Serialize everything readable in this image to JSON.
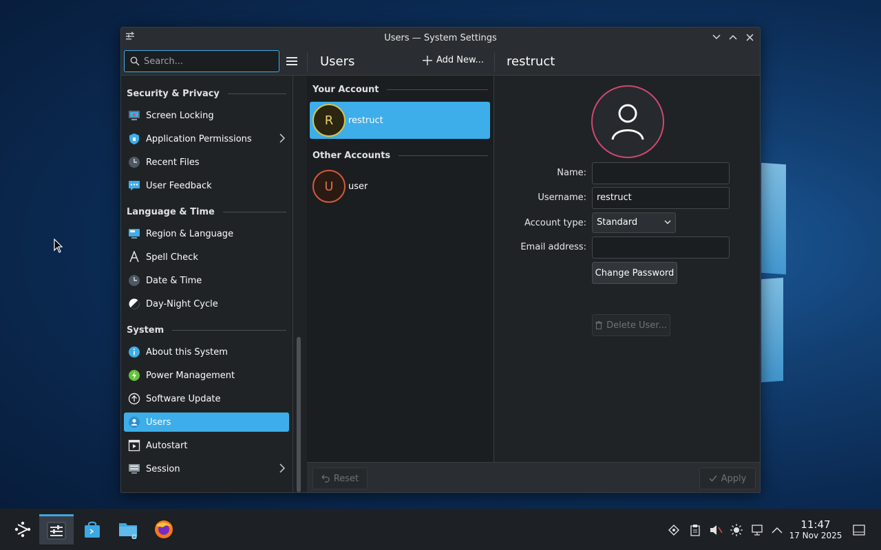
{
  "window": {
    "title": "Users — System Settings"
  },
  "search": {
    "placeholder": "Search..."
  },
  "toolbar": {
    "page_title": "Users",
    "add_new_label": "Add New...",
    "detail_title": "restruct"
  },
  "sidebar": {
    "sections": [
      {
        "title": "Security & Privacy",
        "items": [
          {
            "label": "Screen Locking",
            "icon": "screen-lock-icon"
          },
          {
            "label": "Application Permissions",
            "icon": "shield-icon",
            "has_submenu": true
          },
          {
            "label": "Recent Files",
            "icon": "clock-icon"
          },
          {
            "label": "User Feedback",
            "icon": "feedback-icon"
          }
        ]
      },
      {
        "title": "Language & Time",
        "items": [
          {
            "label": "Region & Language",
            "icon": "flag-icon"
          },
          {
            "label": "Spell Check",
            "icon": "spellcheck-icon"
          },
          {
            "label": "Date & Time",
            "icon": "clock-icon"
          },
          {
            "label": "Day-Night Cycle",
            "icon": "day-night-icon"
          }
        ]
      },
      {
        "title": "System",
        "items": [
          {
            "label": "About this System",
            "icon": "info-icon"
          },
          {
            "label": "Power Management",
            "icon": "power-icon"
          },
          {
            "label": "Software Update",
            "icon": "update-icon"
          },
          {
            "label": "Users",
            "icon": "users-icon",
            "active": true
          },
          {
            "label": "Autostart",
            "icon": "autostart-icon"
          },
          {
            "label": "Session",
            "icon": "session-icon",
            "has_submenu": true
          }
        ]
      }
    ]
  },
  "accounts": {
    "your_header": "Your Account",
    "other_header": "Other Accounts",
    "mine": {
      "initial": "R",
      "name": "restruct"
    },
    "others": [
      {
        "initial": "U",
        "name": "user"
      }
    ]
  },
  "details": {
    "name_label": "Name:",
    "name_value": "",
    "username_label": "Username:",
    "username_value": "restruct",
    "account_type_label": "Account type:",
    "account_type_value": "Standard",
    "email_label": "Email address:",
    "email_value": "",
    "change_password_label": "Change Password",
    "delete_user_label": "Delete User..."
  },
  "footer": {
    "reset_label": "Reset",
    "apply_label": "Apply"
  },
  "taskbar": {
    "time": "11:47",
    "date": "17 Nov 2025"
  },
  "colors": {
    "accent": "#3daee9",
    "window_bg": "#202326",
    "avatar_ring": "#d0486e"
  }
}
